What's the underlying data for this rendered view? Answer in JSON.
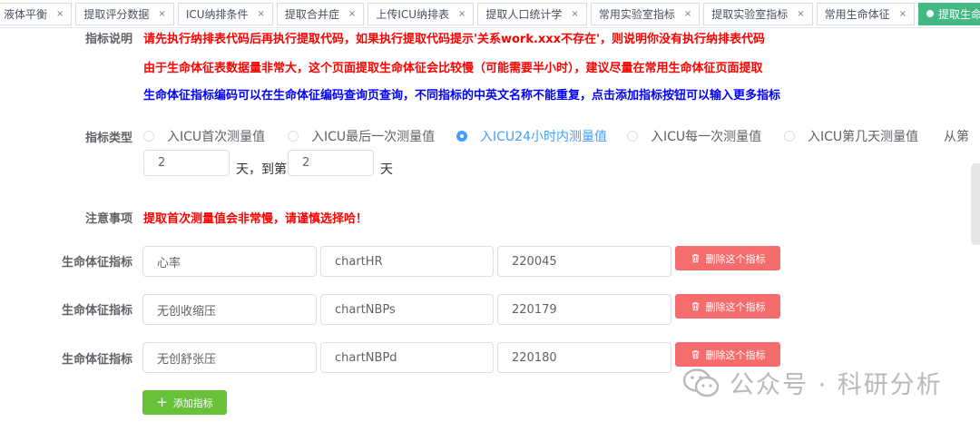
{
  "tabs": [
    {
      "label": "液体平衡",
      "active": false
    },
    {
      "label": "提取评分数据",
      "active": false
    },
    {
      "label": "ICU纳排条件",
      "active": false
    },
    {
      "label": "提取合并症",
      "active": false
    },
    {
      "label": "上传ICU纳排表",
      "active": false
    },
    {
      "label": "提取人口统计学",
      "active": false
    },
    {
      "label": "常用实验室指标",
      "active": false
    },
    {
      "label": "提取实验室指标",
      "active": false
    },
    {
      "label": "常用生命体征",
      "active": false
    },
    {
      "label": "提取生命体征",
      "active": true
    }
  ],
  "tab_close_glyph": "×",
  "instructions": {
    "label": "指标说明",
    "lines": [
      {
        "text": "请先执行纳排表代码后再执行提取代码，如果执行提取代码提示'关系work.xxx不存在'，则说明你没有执行纳排表代码",
        "color": "#ff0000"
      },
      {
        "text": "由于生命体征表数据量非常大，这个页面提取生命体征会比较慢（可能需要半小时），建议尽量在常用生命体征页面提取",
        "color": "#ff0000"
      },
      {
        "text": "生命体征指标编码可以在生命体征编码查询页查询，不同指标的中英文名称不能重复，点击添加指标按钮可以输入更多指标",
        "color": "#0000ff"
      }
    ]
  },
  "indicator_type": {
    "label": "指标类型",
    "options": [
      {
        "label": "入ICU首次测量值",
        "checked": false
      },
      {
        "label": "入ICU最后一次测量值",
        "checked": false
      },
      {
        "label": "入ICU24小时内测量值",
        "checked": true
      },
      {
        "label": "入ICU每一次测量值",
        "checked": false
      },
      {
        "label": "入ICU第几天测量值",
        "checked": false
      }
    ],
    "from_text": "从第",
    "day_from": "2",
    "day_to_text": "天，到第",
    "day_to": "2",
    "day_suffix": "天"
  },
  "notes": {
    "label": "注意事项",
    "text": "提取首次测量值会非常慢，请谨慎选择哈！"
  },
  "vital_signs": {
    "row_label": "生命体征指标",
    "delete_label": "删除这个指标",
    "rows": [
      {
        "cn_name": "心率",
        "en_name": "chartHR",
        "code": "220045"
      },
      {
        "cn_name": "无创收缩压",
        "en_name": "chartNBPs",
        "code": "220179"
      },
      {
        "cn_name": "无创舒张压",
        "en_name": "chartNBPd",
        "code": "220180"
      }
    ]
  },
  "add_button": {
    "label": "添加指标"
  },
  "watermark": {
    "text": "公众号 · 科研分析",
    "icon": "wechat-icon"
  },
  "colors": {
    "active_tab": "#42b983",
    "radio_checked": "#409eff",
    "danger": "#f56c6c",
    "success": "#67c23a",
    "warning_text": "#ff0000",
    "info_text": "#0000ff"
  }
}
